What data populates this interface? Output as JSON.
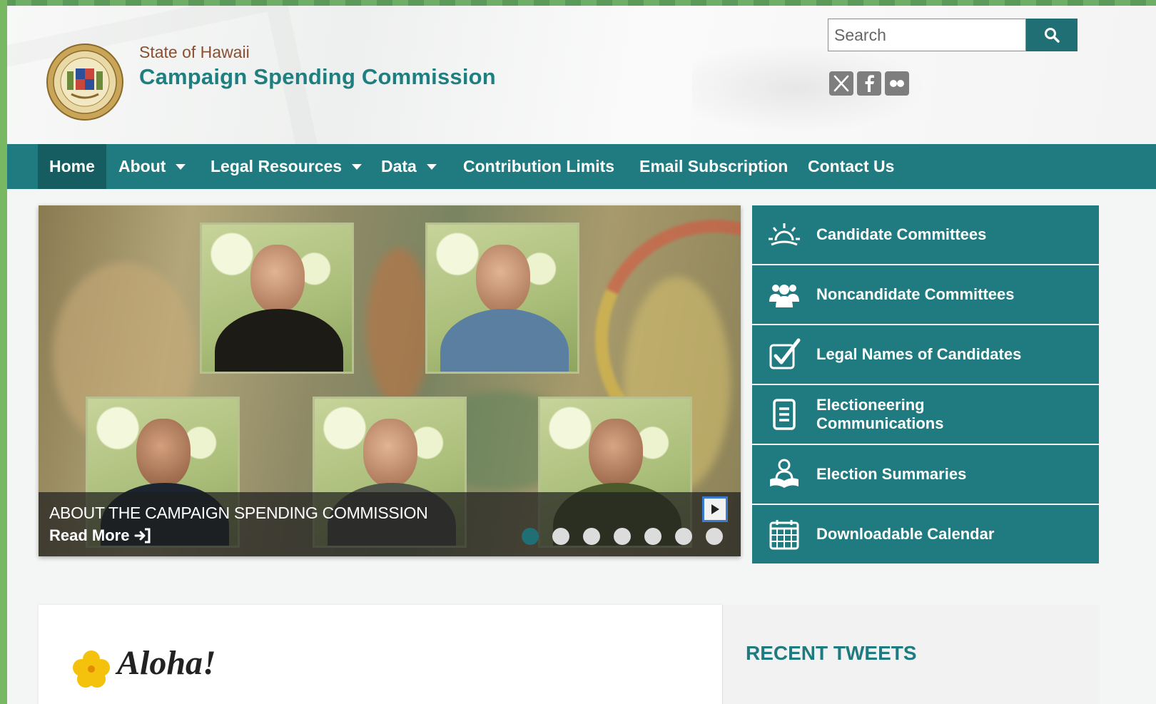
{
  "header": {
    "state_name": "State of Hawaii",
    "agency_name": "Campaign Spending Commission",
    "seal_icon": "state-seal-icon"
  },
  "search": {
    "placeholder": "Search",
    "button_icon": "search-icon"
  },
  "social": [
    "x-twitter-icon",
    "facebook-icon",
    "flickr-icon"
  ],
  "nav": {
    "items": [
      {
        "label": "Home",
        "active": true
      },
      {
        "label": "About",
        "dropdown": true
      },
      {
        "label": "Legal Resources",
        "dropdown": true
      },
      {
        "label": "Data",
        "dropdown": true
      },
      {
        "label": "Contribution Limits"
      },
      {
        "label": "Email Subscription"
      },
      {
        "label": "Contact Us"
      }
    ]
  },
  "slider": {
    "caption_title": "ABOUT THE CAMPAIGN SPENDING COMMISSION",
    "read_more": "Read More",
    "slide_count": 7,
    "active_slide": 1
  },
  "quick_links": [
    {
      "label": "Candidate Committees",
      "icon": "sunrise-icon"
    },
    {
      "label": "Noncandidate Committees",
      "icon": "group-icon"
    },
    {
      "label": "Legal Names of Candidates",
      "icon": "checkbox-icon"
    },
    {
      "label": "Electioneering Communications",
      "icon": "document-icon"
    },
    {
      "label": "Election Summaries",
      "icon": "reader-icon"
    },
    {
      "label": "Downloadable Calendar",
      "icon": "calendar-icon"
    }
  ],
  "welcome": {
    "title": "Aloha!",
    "icon": "hibiscus-icon"
  },
  "tweets": {
    "title": "RECENT TWEETS"
  },
  "colors": {
    "primary": "#1f7b80",
    "primary_dark": "#155d61",
    "state_brown": "#8a4f2f",
    "accent_green": "#79b862"
  }
}
